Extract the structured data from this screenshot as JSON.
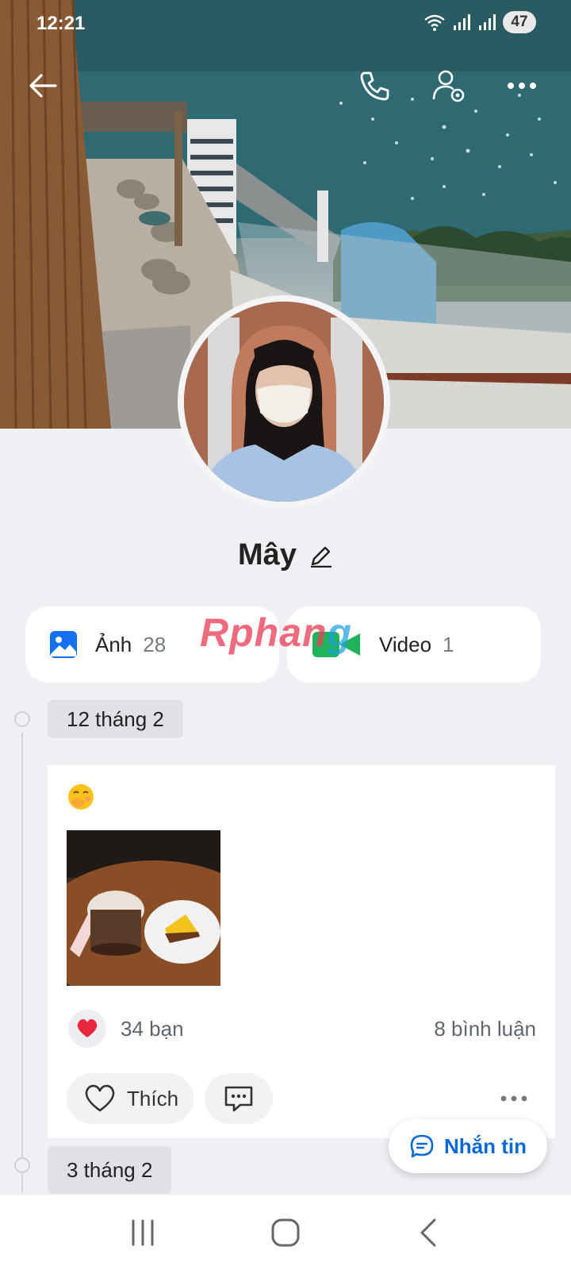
{
  "status_bar": {
    "time": "12:21",
    "battery": "47"
  },
  "profile": {
    "name": "Mây"
  },
  "media": {
    "photos": {
      "label": "Ảnh",
      "count": "28"
    },
    "videos": {
      "label": "Video",
      "count": "1"
    }
  },
  "watermark": {
    "part1": "Rphan",
    "part2": "g"
  },
  "timeline": [
    {
      "date": "12 tháng 2",
      "post": {
        "emoji_icon": "face-with-hand-over-mouth",
        "reactions": "34 bạn",
        "comments": "8 bình luận",
        "like_label": "Thích"
      }
    },
    {
      "date": "3 tháng 2"
    }
  ],
  "message_button": {
    "label": "Nhắn tin"
  },
  "colors": {
    "accent": "#0a68d8",
    "heart": "#e8283f",
    "photo_icon": "#1570ef",
    "video_icon": "#21b35a"
  }
}
